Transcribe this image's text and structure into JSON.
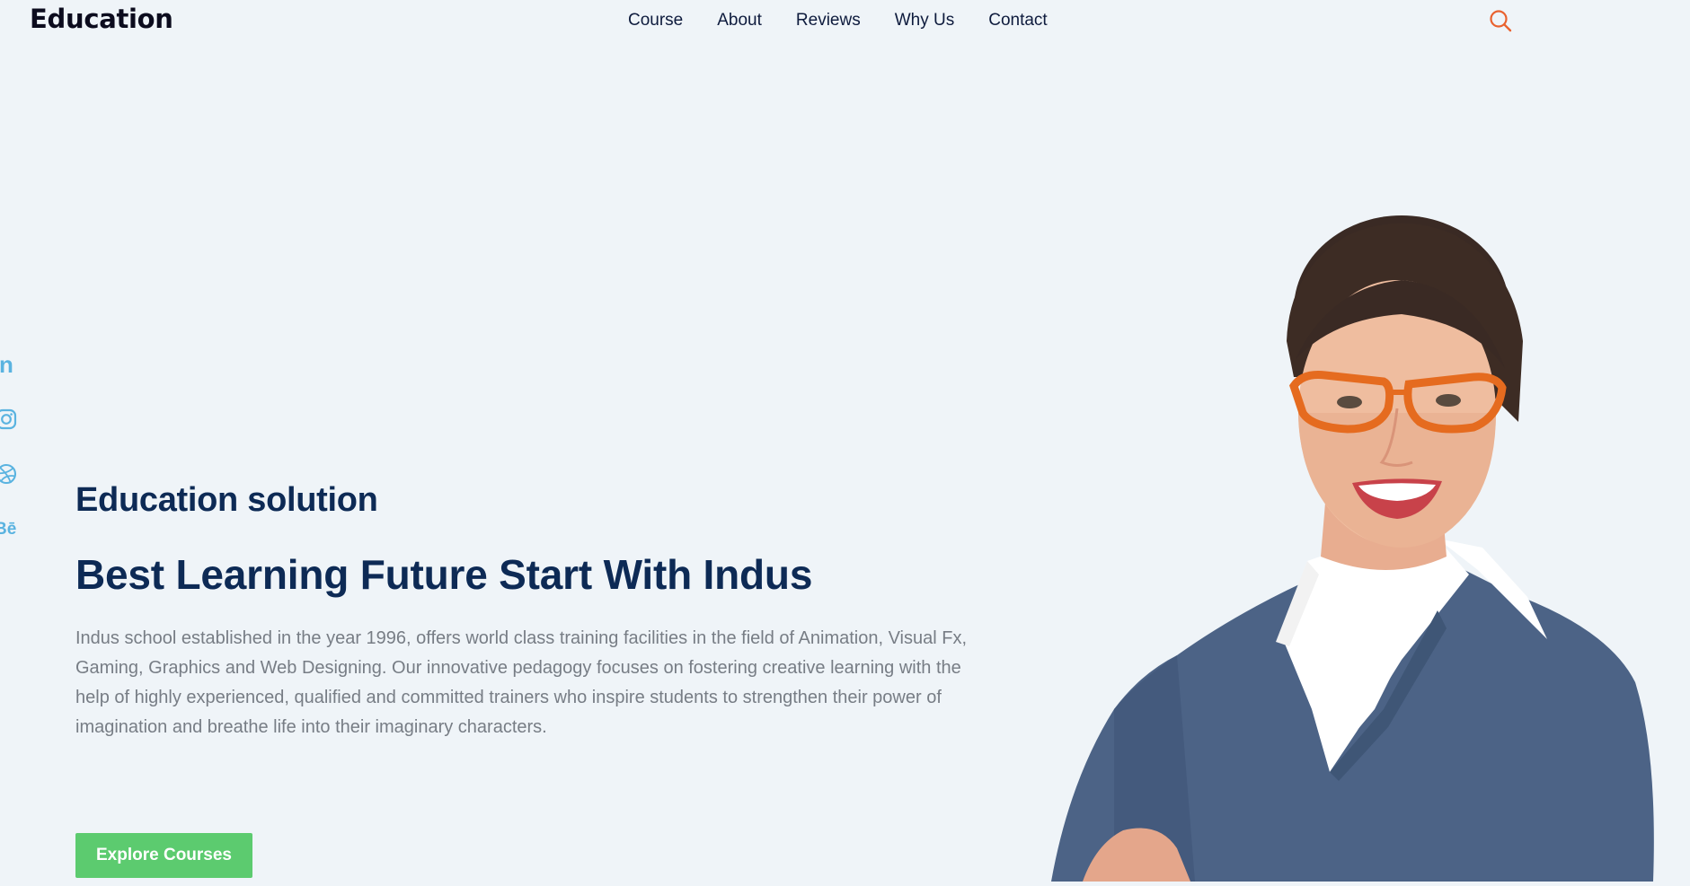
{
  "brand": {
    "logo_text": "Education"
  },
  "nav": {
    "items": [
      "Course",
      "About",
      "Reviews",
      "Why Us",
      "Contact"
    ]
  },
  "header": {
    "search_icon": "search-icon",
    "accent_color": "#e9622f"
  },
  "social": {
    "icons": [
      "linkedin-icon",
      "instagram-icon",
      "dribbble-icon",
      "behance-icon"
    ],
    "color": "#5ab3e0"
  },
  "hero": {
    "subtitle": "Education solution",
    "title": "Best Learning Future Start With Indus",
    "description": "Indus school established in the year 1996, offers world class training facilities in the field of Animation, Visual Fx, Gaming, Graphics and Web Designing. Our innovative pedagogy focuses on fostering creative learning with the help of highly experienced, qualified and committed trainers who inspire students to strengthen their power of imagination and breathe life into their imaginary characters.",
    "cta_label": "Explore Courses",
    "cta_color": "#5ccb6f"
  }
}
